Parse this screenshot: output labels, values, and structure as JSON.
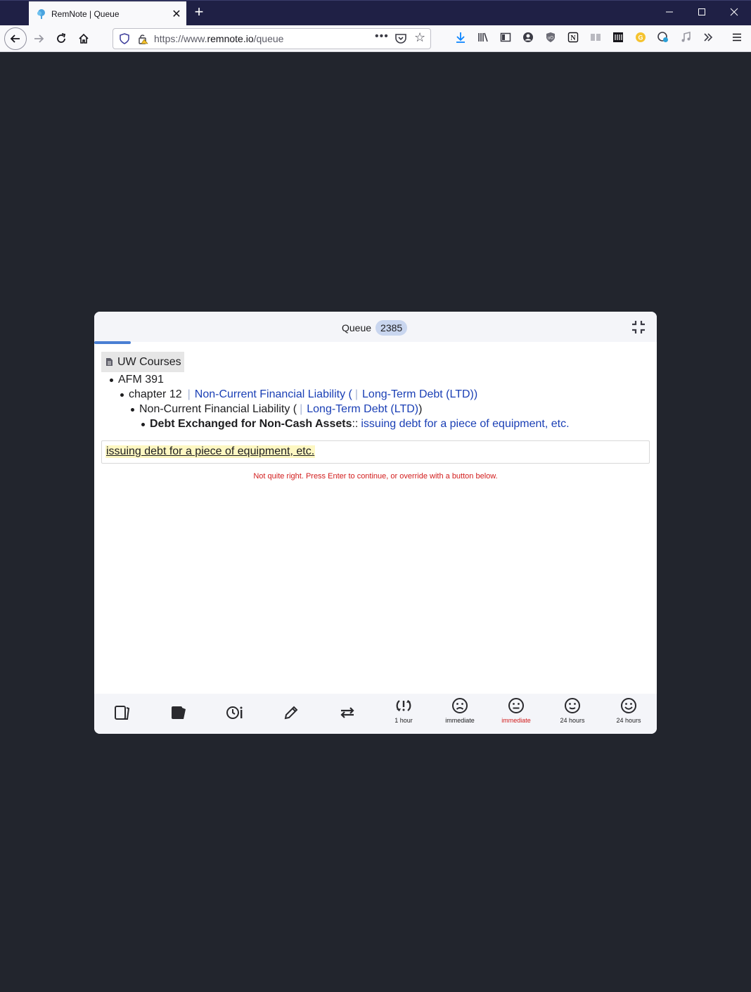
{
  "browser": {
    "tab_title": "RemNote | Queue",
    "url_prefix": "https://www.",
    "url_host": "remnote.io",
    "url_path": "/queue",
    "new_tab_glyph": "+",
    "tab_close_glyph": "✕"
  },
  "queue": {
    "title": "Queue",
    "count": "2385",
    "breadcrumb": "UW Courses",
    "tree": {
      "level1": "AFM 391",
      "level2_text": "chapter 12",
      "level2_link_a": "Non-Current Financial Liability (",
      "level2_link_b": "Long-Term Debt (LTD))",
      "level3_text": "Non-Current Financial Liability (",
      "level3_link": "Long-Term Debt (LTD)",
      "level3_close": ")",
      "level4_bold": "Debt Exchanged for Non-Cash Assets",
      "level4_sep": "::",
      "level4_link": "issuing debt for a piece of equipment, etc."
    },
    "answer": "issuing debt for a piece of equipment, etc.",
    "feedback": "Not quite right. Press Enter to continue, or override with a button below.",
    "footer": {
      "b1_label": "1 hour",
      "b2_label": "immediate",
      "b3_label": "immediate",
      "b4_label": "24 hours",
      "b5_label": "24 hours"
    }
  },
  "colors": {
    "link": "#1a3fb5",
    "error": "#d21c1c",
    "highlight": "#fdf7c2",
    "accent": "#4a7fd3"
  }
}
